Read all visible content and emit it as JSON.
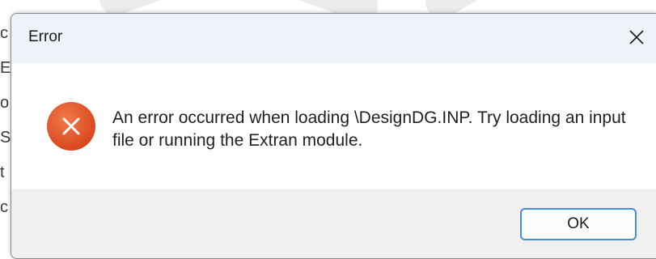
{
  "dialog": {
    "title": "Error",
    "close_icon": "close-icon",
    "error_icon": "error-icon",
    "message": "An error occurred when loading \\DesignDG.INP. Try loading an input file or running the Extran module.",
    "ok_label": "OK"
  },
  "background": {
    "glyphs": [
      "c",
      "E",
      "o",
      "S",
      "t",
      "c"
    ]
  },
  "colors": {
    "error_red": "#e0532a",
    "button_border": "#4a8ad8",
    "titlebar_bg": "#eef3f9",
    "footer_bg": "#f0f0f0"
  }
}
